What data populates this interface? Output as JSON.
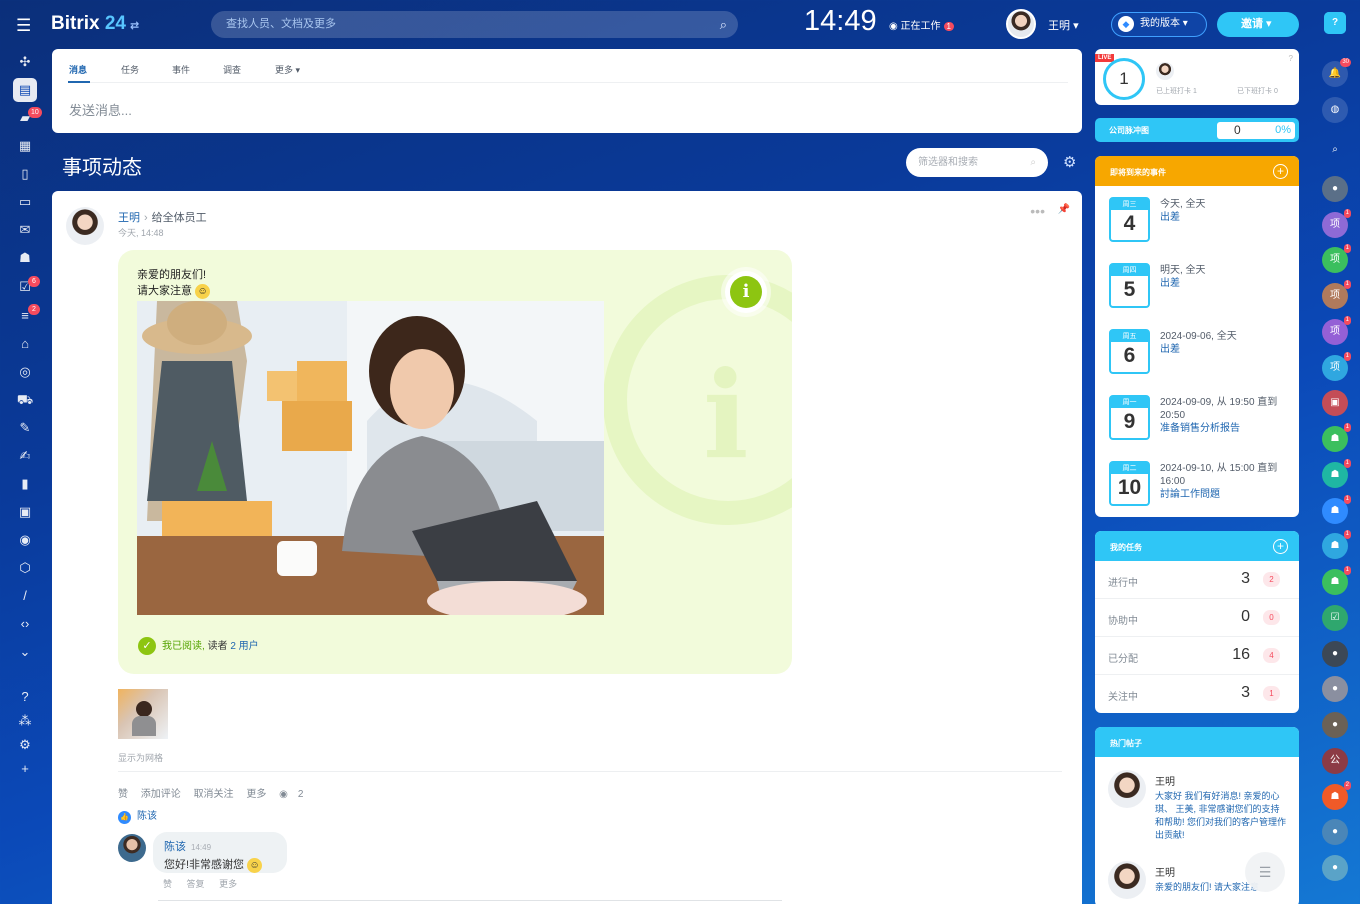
{
  "header": {
    "app_name": "Bitrix",
    "app_version": "24",
    "search_placeholder": "查找人员、文档及更多",
    "clock": "14:49",
    "work_status": "正在工作",
    "work_badge": "1",
    "user_name": "王明",
    "version_label": "我的版本",
    "invite_label": "邀请",
    "help_label": "?"
  },
  "left_rail": {
    "icons": [
      "connections-icon",
      "feed-icon",
      "chat-icon",
      "calendar-icon",
      "document-icon",
      "drive-icon",
      "mail-icon",
      "groups-icon",
      "tasks-icon",
      "crm-icon",
      "company-icon",
      "target-icon",
      "shop-icon",
      "sign-icon",
      "signature-icon",
      "analytics-icon",
      "booking-icon",
      "robot-icon",
      "store-icon",
      "automation-icon",
      "developer-icon",
      "more-icon",
      "help-icon",
      "sitemap-icon",
      "settings-icon",
      "add-icon"
    ],
    "badges": {
      "chat": "10",
      "tasks": "6",
      "crm": "2"
    }
  },
  "composer": {
    "tabs": [
      "消息",
      "任务",
      "事件",
      "调查",
      "更多"
    ],
    "placeholder": "发送消息..."
  },
  "feed": {
    "title": "事项动态",
    "filter_placeholder": "筛选器和搜索"
  },
  "post": {
    "author": "王明",
    "recipient": "给全体员工",
    "time": "今天, 14:48",
    "line1": "亲爱的朋友们!",
    "line2": "请大家注意",
    "read_label": "我已阅读,",
    "readers_label": "读者",
    "readers_count": "2 用户",
    "grid_label": "显示为网格",
    "actions": [
      "赞",
      "添加评论",
      "取消关注",
      "更多"
    ],
    "views": "2",
    "liked_by": "陈该",
    "comment": {
      "author": "陈该",
      "time": "14:49",
      "text": "您好!非常感谢您",
      "actions": [
        "赞",
        "答复",
        "更多"
      ]
    }
  },
  "timeman": {
    "live": "LIVE",
    "count": "1",
    "checked_in": "已上班打卡 1",
    "checked_out": "已下班打卡 0"
  },
  "pulse": {
    "label": "公司脉冲图",
    "value": "0",
    "percent": "0%"
  },
  "events": {
    "title": "即将到来的事件",
    "items": [
      {
        "weekday": "周三",
        "day": "4",
        "when": "今天, 全天",
        "what": "出差"
      },
      {
        "weekday": "周四",
        "day": "5",
        "when": "明天, 全天",
        "what": "出差"
      },
      {
        "weekday": "周五",
        "day": "6",
        "when": "2024-09-06, 全天",
        "what": "出差"
      },
      {
        "weekday": "周一",
        "day": "9",
        "when": "2024-09-09, 从 19:50 直到 20:50",
        "what": "准备销售分析报告"
      },
      {
        "weekday": "周二",
        "day": "10",
        "when": "2024-09-10, 从 15:00 直到 16:00",
        "what": "討論工作問題"
      }
    ]
  },
  "tasks": {
    "title": "我的任务",
    "rows": [
      {
        "label": "进行中",
        "value": "3",
        "badge": "2"
      },
      {
        "label": "协助中",
        "value": "0",
        "badge": "0"
      },
      {
        "label": "已分配",
        "value": "16",
        "badge": "4"
      },
      {
        "label": "关注中",
        "value": "3",
        "badge": "1"
      }
    ]
  },
  "hot_posts": {
    "title": "热门帖子",
    "items": [
      {
        "author": "王明",
        "text": "大家好 我们有好消息! 亲爱的心琪、 王美, 非常感谢您们的支持和帮助! 您们对我们的客户管理作出贡献!"
      },
      {
        "author": "王明",
        "text": "亲爱的朋友们! 请大家注意"
      }
    ]
  },
  "right_rail": {
    "notifications_badge": "30",
    "project_label": "项",
    "company_label": "公",
    "colors": {
      "accent": "#2fc6f6",
      "brand": "#0b49b8",
      "alert": "#f54b5e",
      "green": "#8dc511",
      "events": "#f7a700"
    }
  }
}
